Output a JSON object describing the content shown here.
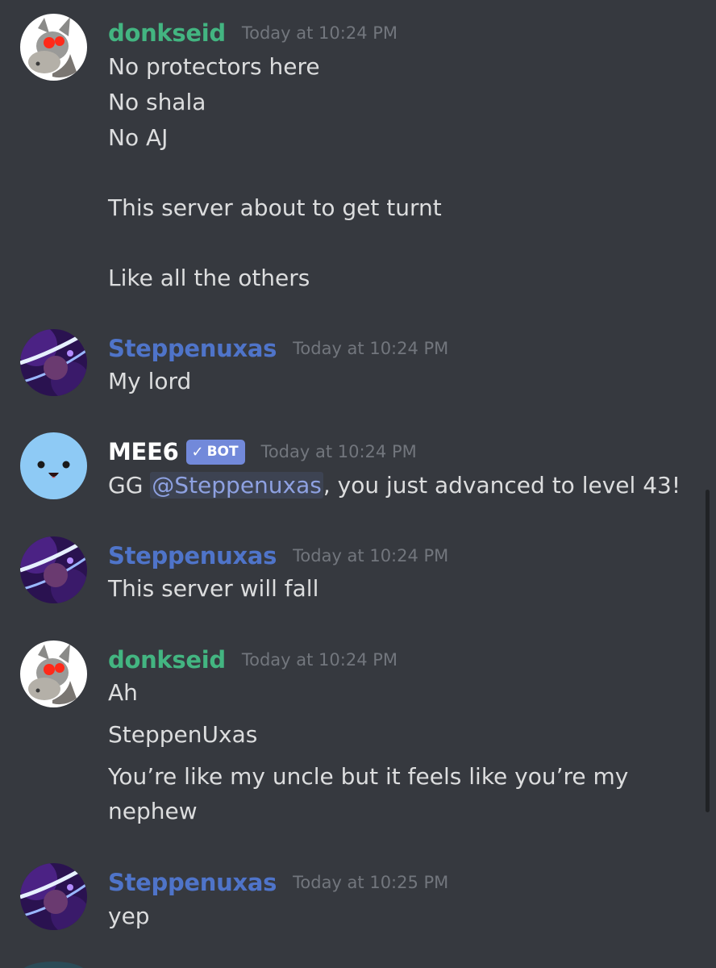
{
  "colors": {
    "background": "#36393f",
    "donkseid": "#43b581",
    "steppenuxas": "#4f74c9",
    "mee6": "#ffffff",
    "message_text": "#dcddde",
    "timestamp": "#72767d",
    "bot_badge": "#7289da",
    "mention_text": "#8ea1e1"
  },
  "messages": [
    {
      "author": "donkseid",
      "avatar": "donkey-avatar-icon",
      "timestamp": "Today at 10:24 PM",
      "lines": [
        "No protectors here",
        "No shala",
        "No AJ",
        "This server about to get turnt",
        "Like all the others"
      ]
    },
    {
      "author": "Steppenuxas",
      "avatar": "neon-avatar-icon",
      "timestamp": "Today at 10:24 PM",
      "lines": [
        "My lord"
      ]
    },
    {
      "author": "MEE6",
      "avatar": "mee6-bot-avatar-icon",
      "badge": "BOT",
      "timestamp": "Today at 10:24 PM",
      "text_before": "GG ",
      "mention": "@Steppenuxas",
      "text_after": ", you just advanced to level 43!"
    },
    {
      "author": "Steppenuxas",
      "avatar": "neon-avatar-icon",
      "timestamp": "Today at 10:24 PM",
      "lines": [
        "This server will fall"
      ]
    },
    {
      "author": "donkseid",
      "avatar": "donkey-avatar-icon",
      "timestamp": "Today at 10:24 PM",
      "lines": [
        "Ah",
        "SteppenUxas",
        "You’re like my uncle but it feels like you’re my",
        "nephew"
      ]
    },
    {
      "author": "Steppenuxas",
      "avatar": "neon-avatar-icon",
      "timestamp": "Today at 10:25 PM",
      "lines": [
        "yep"
      ]
    }
  ]
}
